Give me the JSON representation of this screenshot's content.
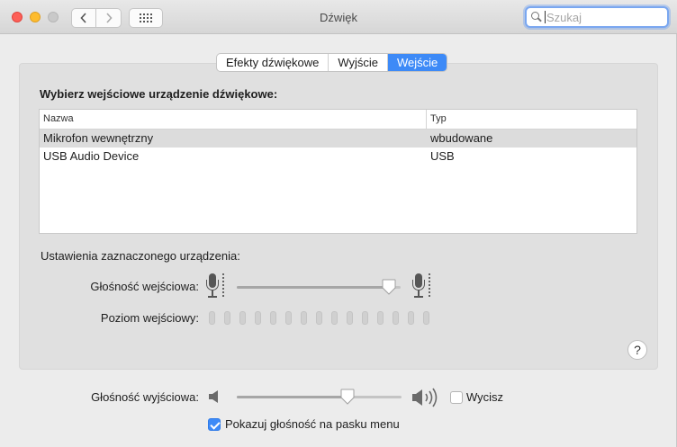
{
  "window": {
    "title": "Dźwięk"
  },
  "search": {
    "placeholder": "Szukaj"
  },
  "tabs": [
    {
      "label": "Efekty dźwiękowe",
      "active": false
    },
    {
      "label": "Wyjście",
      "active": false
    },
    {
      "label": "Wejście",
      "active": true
    }
  ],
  "input_panel": {
    "heading": "Wybierz wejściowe urządzenie dźwiękowe:",
    "columns": [
      "Nazwa",
      "Typ"
    ],
    "devices": [
      {
        "name": "Mikrofon wewnętrzny",
        "type": "wbudowane",
        "selected": true
      },
      {
        "name": "USB Audio Device",
        "type": "USB",
        "selected": false
      }
    ],
    "settings_label": "Ustawienia zaznaczonego urządzenia:",
    "input_volume_label": "Głośność wejściowa:",
    "input_volume_level": 0.93,
    "input_level_label": "Poziom wejściowy:",
    "input_level_segments": 15,
    "help": "?"
  },
  "output": {
    "volume_label": "Głośność wyjściowa:",
    "volume_level": 0.67,
    "mute_label": "Wycisz",
    "mute_checked": false,
    "show_in_menubar_label": "Pokazuj głośność na pasku menu",
    "show_in_menubar_checked": true
  },
  "colors": {
    "accent": "#3d8af7",
    "close": "#fd5f57",
    "minimize": "#febc2e"
  }
}
